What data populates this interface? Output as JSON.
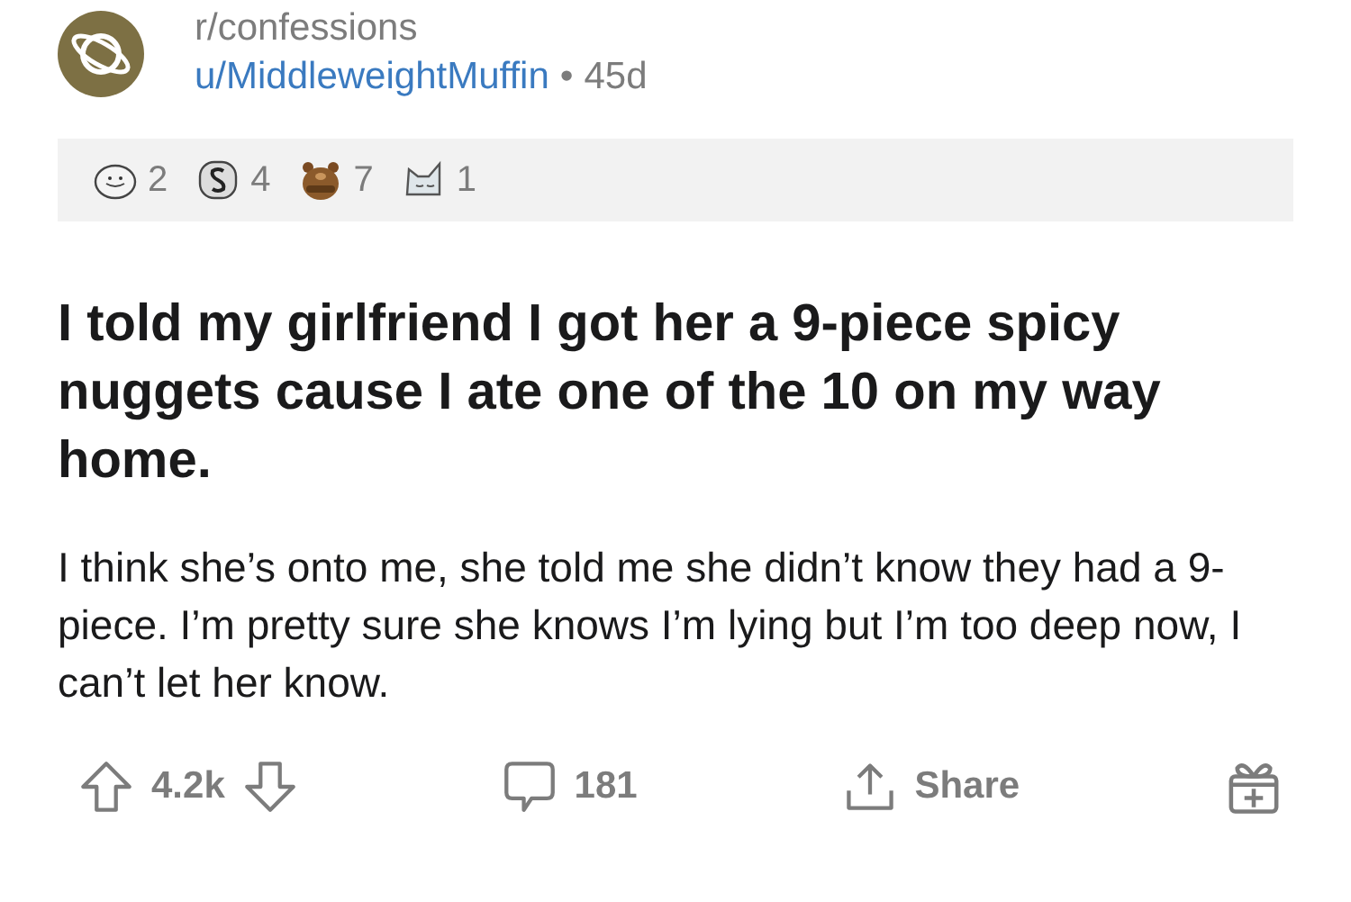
{
  "post": {
    "subreddit": "r/confessions",
    "author": "u/MiddleweightMuffin",
    "separator": "•",
    "age": "45d",
    "awards": [
      {
        "kind": "seal",
        "count": "2"
      },
      {
        "kind": "coin",
        "count": "4"
      },
      {
        "kind": "bear",
        "count": "7"
      },
      {
        "kind": "cat",
        "count": "1"
      }
    ],
    "title": "I told my girlfriend I got her a 9-piece spicy nuggets cause I ate one of the 10 on my way home.",
    "body": "I think she’s onto me, she told me she didn’t know they had a 9-piece. I’m pretty sure she knows I’m lying but I’m too deep now, I can’t let her know.",
    "score": "4.2k",
    "comments": "181",
    "share": "Share"
  }
}
